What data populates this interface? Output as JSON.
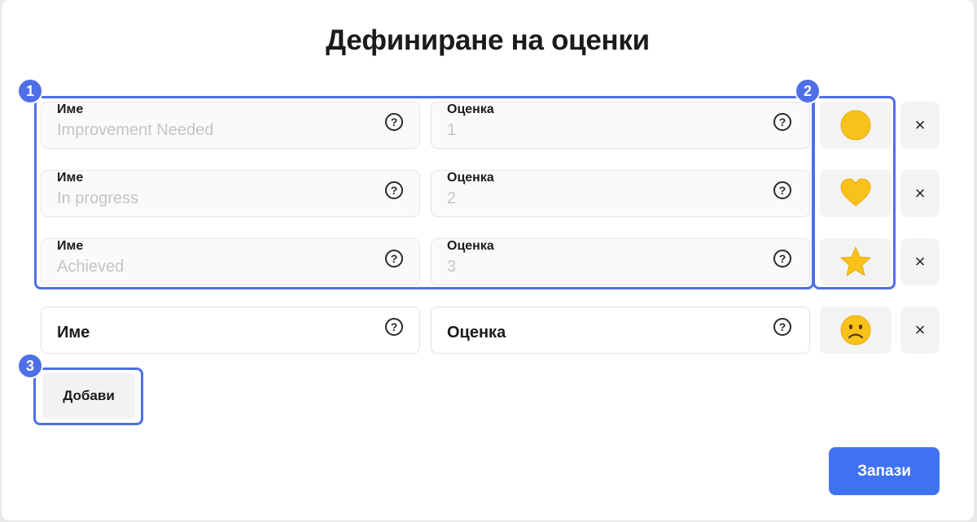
{
  "dialog": {
    "title": "Дефиниране на оценки"
  },
  "fields": {
    "name_label": "Име",
    "grade_label": "Оценка",
    "help_glyph": "?"
  },
  "rows": [
    {
      "name_value": "Improvement Needed",
      "grade_value": "1",
      "emoji": "yellow-circle"
    },
    {
      "name_value": "In progress",
      "grade_value": "2",
      "emoji": "yellow-heart"
    },
    {
      "name_value": "Achieved",
      "grade_value": "3",
      "emoji": "star"
    }
  ],
  "new_row": {
    "name_placeholder": "Име",
    "grade_placeholder": "Оценка",
    "emoji": "frowning-face"
  },
  "delete_glyph": "×",
  "buttons": {
    "add_label": "Добави",
    "save_label": "Запази"
  },
  "annotations": {
    "badges": [
      "1",
      "2",
      "3"
    ],
    "color": "#4f6fe8"
  },
  "colors": {
    "accent": "#3f72f2",
    "emoji_yellow": "#f8c21b"
  }
}
